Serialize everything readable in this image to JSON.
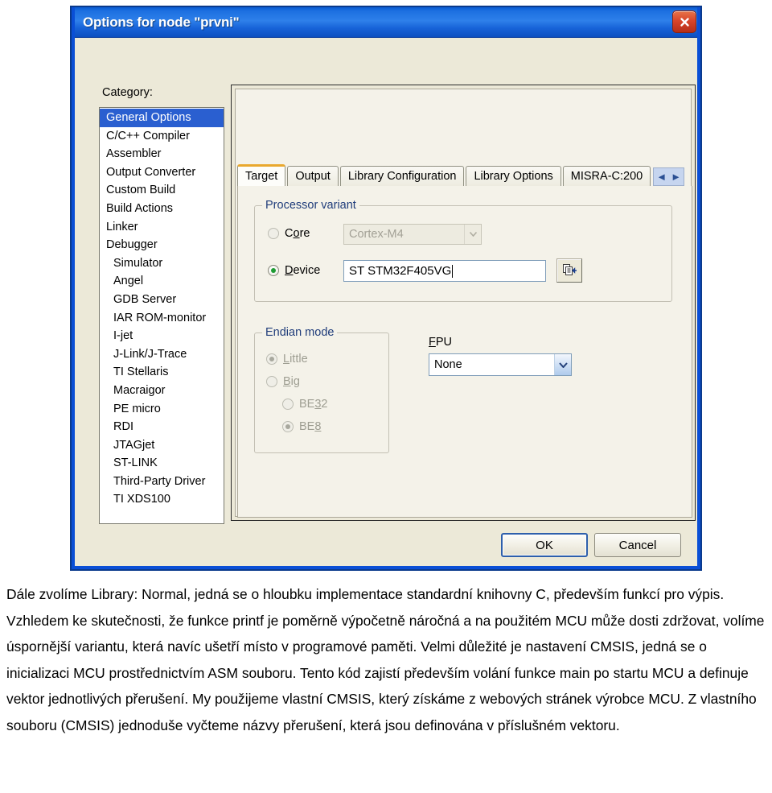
{
  "dialog": {
    "title": "Options for node \"prvni\"",
    "close_icon": "close-icon",
    "category_label": "Category:",
    "categories": [
      {
        "label": "General Options",
        "indent": false,
        "selected": true
      },
      {
        "label": "C/C++ Compiler",
        "indent": false,
        "selected": false
      },
      {
        "label": "Assembler",
        "indent": false,
        "selected": false
      },
      {
        "label": "Output Converter",
        "indent": false,
        "selected": false
      },
      {
        "label": "Custom Build",
        "indent": false,
        "selected": false
      },
      {
        "label": "Build Actions",
        "indent": false,
        "selected": false
      },
      {
        "label": "Linker",
        "indent": false,
        "selected": false
      },
      {
        "label": "Debugger",
        "indent": false,
        "selected": false
      },
      {
        "label": "Simulator",
        "indent": true,
        "selected": false
      },
      {
        "label": "Angel",
        "indent": true,
        "selected": false
      },
      {
        "label": "GDB Server",
        "indent": true,
        "selected": false
      },
      {
        "label": "IAR ROM-monitor",
        "indent": true,
        "selected": false
      },
      {
        "label": "I-jet",
        "indent": true,
        "selected": false
      },
      {
        "label": "J-Link/J-Trace",
        "indent": true,
        "selected": false
      },
      {
        "label": "TI Stellaris",
        "indent": true,
        "selected": false
      },
      {
        "label": "Macraigor",
        "indent": true,
        "selected": false
      },
      {
        "label": "PE micro",
        "indent": true,
        "selected": false
      },
      {
        "label": "RDI",
        "indent": true,
        "selected": false
      },
      {
        "label": "JTAGjet",
        "indent": true,
        "selected": false
      },
      {
        "label": "ST-LINK",
        "indent": true,
        "selected": false
      },
      {
        "label": "Third-Party Driver",
        "indent": true,
        "selected": false
      },
      {
        "label": "TI XDS100",
        "indent": true,
        "selected": false
      }
    ],
    "tabs": [
      {
        "label": "Target",
        "active": true
      },
      {
        "label": "Output",
        "active": false
      },
      {
        "label": "Library Configuration",
        "active": false
      },
      {
        "label": "Library Options",
        "active": false
      },
      {
        "label": "MISRA-C:200",
        "active": false
      }
    ],
    "tab_nav": {
      "prev": "◄",
      "next": "►"
    },
    "processor_variant": {
      "title": "Processor variant",
      "core": {
        "label_pre": "C",
        "label_accel": "o",
        "label_post": "re",
        "selected": false,
        "combo_value": "Cortex-M4",
        "disabled": true
      },
      "device": {
        "label_accel": "D",
        "label_post": "evice",
        "selected": true,
        "value": "ST STM32F405VG"
      },
      "picker_icon": "device-picker-icon"
    },
    "endian_mode": {
      "title": "Endian mode",
      "disabled": true,
      "options": [
        {
          "label_accel": "L",
          "label_post": "ittle",
          "selected": true,
          "indent": false
        },
        {
          "label_accel": "B",
          "label_post": "ig",
          "selected": false,
          "indent": false
        },
        {
          "label_pre": "BE",
          "label_accel": "3",
          "label_post": "2",
          "selected": false,
          "indent": true
        },
        {
          "label_pre": "BE",
          "label_accel": "8",
          "label_post": "",
          "selected": true,
          "indent": true
        }
      ]
    },
    "fpu": {
      "label_accel": "F",
      "label_post": "PU",
      "value": "None"
    },
    "buttons": {
      "ok": "OK",
      "cancel": "Cancel"
    }
  },
  "body_text": {
    "paragraph": "Dále zvolíme Library: Normal, jedná se o hloubku implementace standardní knihovny C, především funkcí pro výpis. Vzhledem ke skutečnosti, že funkce printf je poměrně výpočetně náročná a na použitém MCU může dosti zdržovat, volíme úspornější variantu, která navíc ušetří místo v programové paměti. Velmi důležité je nastavení CMSIS, jedná se o inicializaci MCU prostřednictvím ASM souboru. Tento kód zajistí především volání funkce main po startu MCU a definuje vektor jednotlivých přerušení. My použijeme vlastní CMSIS, který získáme z webových stránek výrobce MCU. Z vlastního souboru (CMSIS) jednoduše vyčteme názvy přerušení, která jsou definována v příslušném vektoru."
  },
  "colors": {
    "titlebar_blue": "#1C6FE0",
    "dialog_face": "#ECE9D8",
    "selection_blue": "#2A5FD0",
    "active_tab_accent": "#E9A82E",
    "group_title_blue": "#1F3C7A",
    "radio_dot_green": "#1E9B32",
    "close_red": "#D8452A"
  }
}
